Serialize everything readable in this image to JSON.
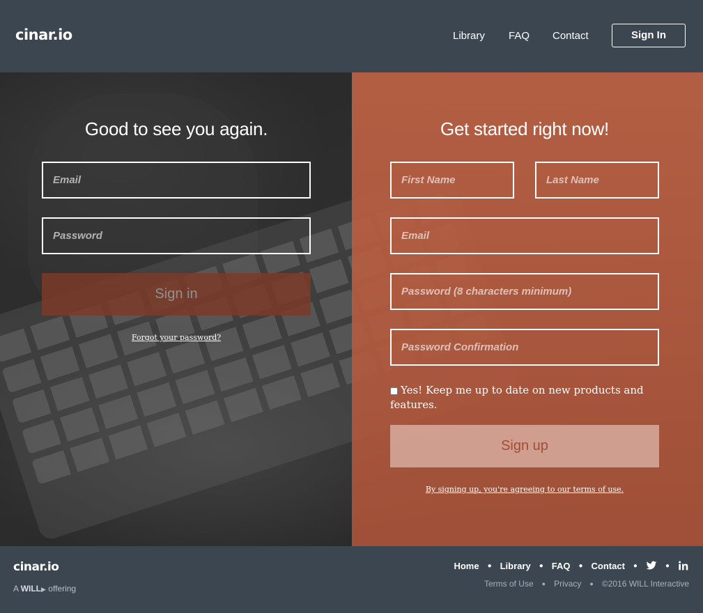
{
  "header": {
    "logo": "cinar.io",
    "nav": [
      "Library",
      "FAQ",
      "Contact"
    ],
    "signin_button": "Sign In"
  },
  "login": {
    "title": "Good to see you again.",
    "email_placeholder": "Email",
    "password_placeholder": "Password",
    "submit_label": "Sign in",
    "forgot_link": "Forgot your password?"
  },
  "signup": {
    "title": "Get started right now!",
    "first_name_placeholder": "First Name",
    "last_name_placeholder": "Last Name",
    "email_placeholder": "Email",
    "password_placeholder": "Password (8 characters minimum)",
    "password_confirm_placeholder": "Password Confirmation",
    "newsletter_label": "Yes! Keep me up to date on new products and features.",
    "submit_label": "Sign up",
    "terms_link": "By signing up, you're agreeing to our terms of use."
  },
  "footer": {
    "logo": "cinar.io",
    "offering_prefix": "A",
    "offering_brand": "WILL",
    "offering_suffix": "offering",
    "links": [
      "Home",
      "Library",
      "FAQ",
      "Contact"
    ],
    "social_icons": [
      "twitter-icon",
      "linkedin-icon"
    ],
    "legal": [
      "Terms of Use",
      "Privacy",
      "©2016 WILL Interactive"
    ]
  },
  "colors": {
    "header_bg": "#3b4651",
    "accent": "#b86044",
    "signin_button_bg": "#7b3a28"
  }
}
